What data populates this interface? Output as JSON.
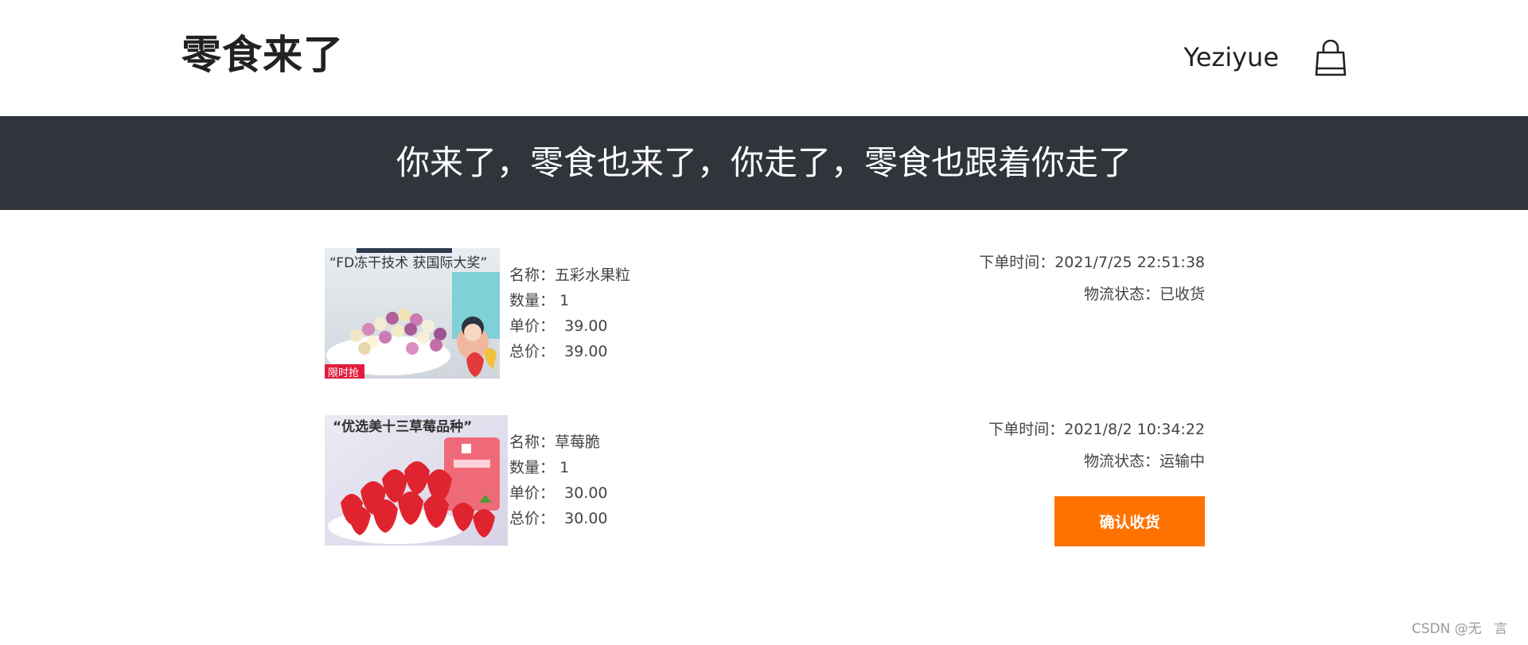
{
  "header": {
    "logo": "零食来了",
    "username": "Yeziyue",
    "cart_icon": "shopping-bag-icon"
  },
  "banner": {
    "text": "你来了，零食也来了，你走了，零食也跟着你走了"
  },
  "orders": [
    {
      "image_caption": "“FD冻干技术 获国际大奖”",
      "image_badge": "限时抢",
      "name_label": "名称：",
      "name": "五彩水果粒",
      "qty_label": "数量：",
      "qty": "1",
      "price_label": "单价：",
      "price": "39.00",
      "total_label": "总价：",
      "total": "39.00",
      "time_label": "下单时间：",
      "time": "2021/7/25 22:51:38",
      "status_label": "物流状态：",
      "status": "已收货"
    },
    {
      "image_caption": "“优选美十三草莓品种”",
      "name_label": "名称：",
      "name": "草莓脆",
      "qty_label": "数量：",
      "qty": "1",
      "price_label": "单价：",
      "price": "30.00",
      "total_label": "总价：",
      "total": "30.00",
      "time_label": "下单时间：",
      "time": "2021/8/2 10:34:22",
      "status_label": "物流状态：",
      "status": "运输中",
      "confirm_label": "确认收货"
    }
  ],
  "watermark": "CSDN @无ﾠ言ﾠ",
  "colors": {
    "banner_bg": "#30353c",
    "accent": "#ff7200"
  }
}
